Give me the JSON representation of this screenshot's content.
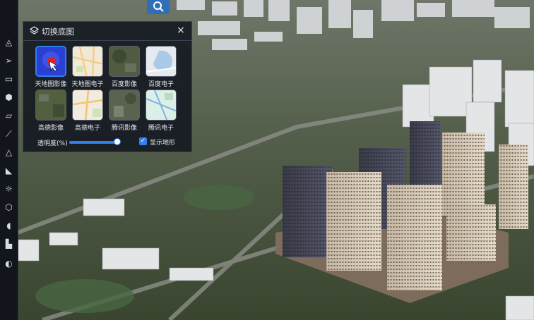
{
  "panel": {
    "title": "切换底图",
    "close_glyph": "×",
    "basemaps": [
      {
        "label": "天地图影像",
        "icon": "basemap-tianditu-imagery",
        "active": true
      },
      {
        "label": "天地图电子",
        "icon": "basemap-tianditu-vector",
        "active": false
      },
      {
        "label": "百度影像",
        "icon": "basemap-baidu-imagery",
        "active": false
      },
      {
        "label": "百度电子",
        "icon": "basemap-baidu-vector",
        "active": false
      },
      {
        "label": "高德影像",
        "icon": "basemap-gaode-imagery",
        "active": false
      },
      {
        "label": "高德电子",
        "icon": "basemap-gaode-vector",
        "active": false
      },
      {
        "label": "腾讯影像",
        "icon": "basemap-tencent-imagery",
        "active": false
      },
      {
        "label": "腾讯电子",
        "icon": "basemap-tencent-vector",
        "active": false
      }
    ],
    "opacity_label": "透明度(%)",
    "opacity_value": 1.0,
    "terrain_label": "显示地形",
    "terrain_checked": true
  },
  "toolbar": {
    "icons": [
      "layers-icon",
      "navigate-icon",
      "window-icon",
      "cube-icon",
      "draw-icon",
      "ruler-icon",
      "terrain-analysis-icon",
      "slope-icon",
      "sunlight-icon",
      "model-icon",
      "sound-icon",
      "building-icon",
      "globe-icon"
    ]
  },
  "colors": {
    "accent": "#2f80ed",
    "panel_bg": "#161a22",
    "toolbar_bg": "#12151c"
  }
}
